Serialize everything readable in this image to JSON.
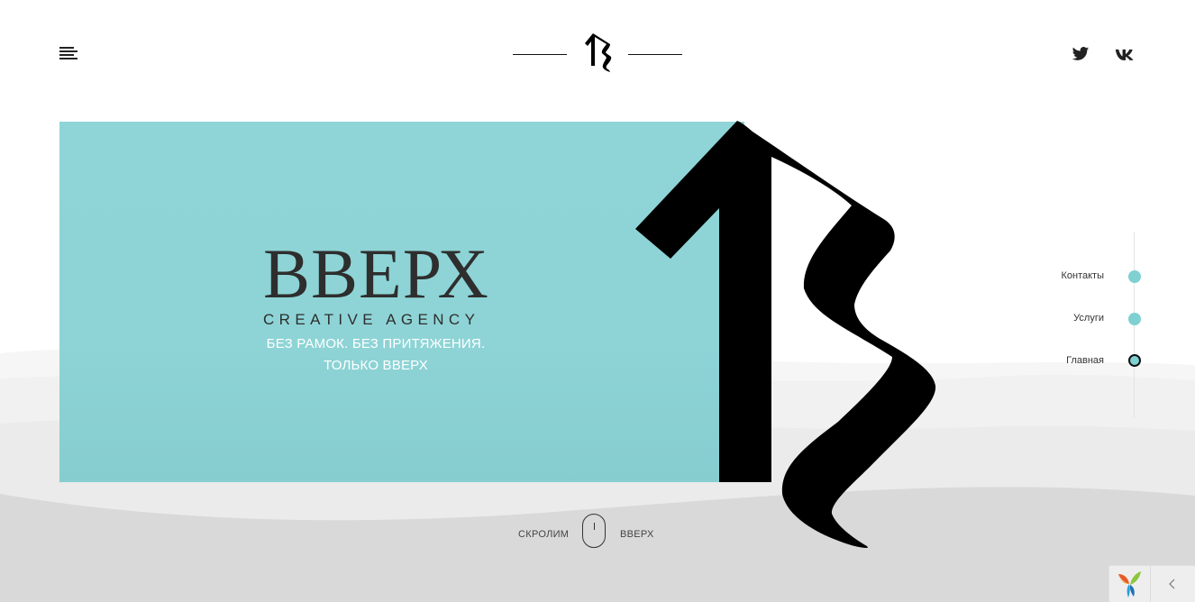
{
  "header": {
    "menu_icon": "hamburger-menu-icon",
    "logo_icon": "agency-logo-mark",
    "social": [
      {
        "name": "twitter",
        "icon": "twitter-icon"
      },
      {
        "name": "vk",
        "icon": "vk-icon"
      }
    ]
  },
  "hero": {
    "title": "ВВЕРХ",
    "subtitle": "CREATIVE AGENCY",
    "tagline_line1": "БЕЗ РАМОК. БЕЗ ПРИТЯЖЕНИЯ.",
    "tagline_line2": "ТОЛЬКО ВВЕРХ",
    "accent_color": "#8fd5d7"
  },
  "scroll_hint": {
    "left_label": "СКРОЛИМ",
    "right_label": "ВВЕРХ"
  },
  "side_nav": {
    "items": [
      {
        "label": "Контакты",
        "active": false
      },
      {
        "label": "Услуги",
        "active": false
      },
      {
        "label": "Главная",
        "active": true
      }
    ],
    "dot_color": "#7fd0d2"
  },
  "corner_widget": {
    "logo_icon": "yii-logo-icon",
    "toggle_icon": "chevron-left-icon"
  }
}
